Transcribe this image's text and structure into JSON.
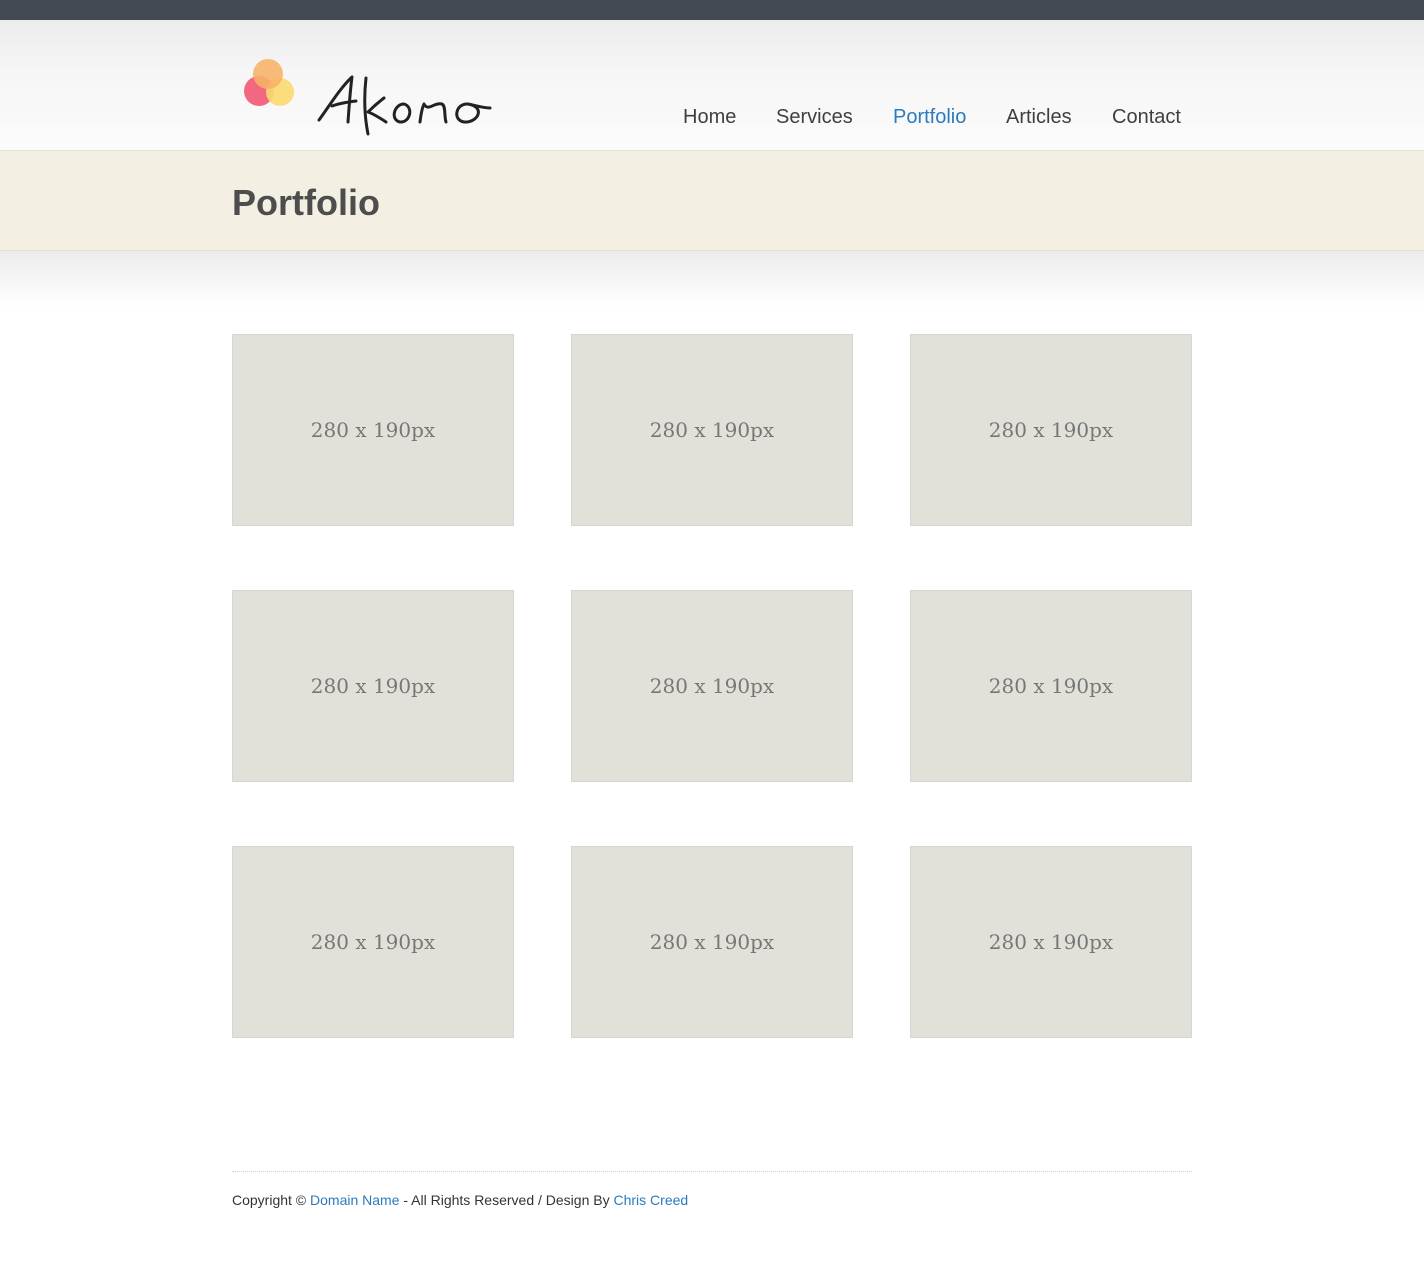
{
  "site": {
    "logo_text": "Akono",
    "logo_icon": "overlapping-circles-logo"
  },
  "nav": {
    "items": [
      {
        "label": "Home",
        "active": false
      },
      {
        "label": "Services",
        "active": false
      },
      {
        "label": "Portfolio",
        "active": true
      },
      {
        "label": "Articles",
        "active": false
      },
      {
        "label": "Contact",
        "active": false
      }
    ]
  },
  "page": {
    "title": "Portfolio"
  },
  "portfolio": {
    "items": [
      {
        "label": "280 x 190px"
      },
      {
        "label": "280 x 190px"
      },
      {
        "label": "280 x 190px"
      },
      {
        "label": "280 x 190px"
      },
      {
        "label": "280 x 190px"
      },
      {
        "label": "280 x 190px"
      },
      {
        "label": "280 x 190px"
      },
      {
        "label": "280 x 190px"
      },
      {
        "label": "280 x 190px"
      }
    ]
  },
  "footer": {
    "copyright_prefix": "Copyright ©",
    "domain_link": "Domain Name",
    "middle_text": "- All Rights Reserved / Design By",
    "designer_link": "Chris Creed"
  },
  "colors": {
    "top_strip": "#444a52",
    "accent_link": "#2b7bbd",
    "title_band": "#f3efe3",
    "placeholder_tile": "#e1e1da",
    "logo_pink": "#f2607a",
    "logo_orange": "#f7b267",
    "logo_yellow": "#fbd970"
  }
}
